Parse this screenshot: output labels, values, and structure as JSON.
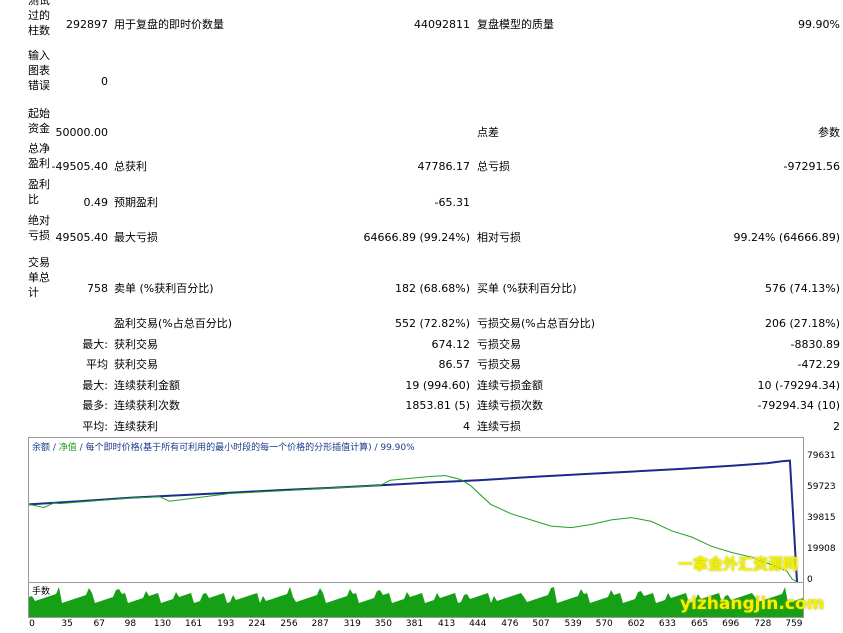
{
  "report": {
    "rows": [
      {
        "label": "测试过的柱数",
        "v1": "292897",
        "l2": "用于复盘的即时价数量",
        "v2": "44092811",
        "l3": "复盘模型的质量",
        "v3": "99.90%"
      },
      {
        "label": "输入图表错误",
        "v1": "0"
      },
      {
        "label": "起始资金",
        "v1": "50000.00",
        "l3": "点差",
        "v3": "参数"
      },
      {
        "label": "总净盈利",
        "v1": "-49505.40",
        "l2": "总获利",
        "v2": "47786.17",
        "l3": "总亏损",
        "v3": "-97291.56"
      },
      {
        "label": "盈利比",
        "v1": "0.49",
        "l2": "预期盈利",
        "v2": "-65.31"
      },
      {
        "label": "绝对亏损",
        "v1": "49505.40",
        "l2": "最大亏损",
        "v2": "64666.89 (99.24%)",
        "l3": "相对亏损",
        "v3": "99.24% (64666.89)"
      },
      {
        "label": "交易单总计",
        "v1": "758",
        "l2": "卖单 (%获利百分比)",
        "v2": "182 (68.68%)",
        "l3": "买单 (%获利百分比)",
        "v3": "576 (74.13%)"
      },
      {
        "l2": "盈利交易(%占总百分比)",
        "v2": "552 (72.82%)",
        "l3": "亏损交易(%占总百分比)",
        "v3": "206 (27.18%)"
      },
      {
        "cat": "最大:",
        "l2": "获利交易",
        "v2": "674.12",
        "l3": "亏损交易",
        "v3": "-8830.89"
      },
      {
        "cat": "平均",
        "l2": "获利交易",
        "v2": "86.57",
        "l3": "亏损交易",
        "v3": "-472.29"
      },
      {
        "cat": "最大:",
        "l2": "连续获利金额",
        "v2": "19 (994.60)",
        "l3": "连续亏损金额",
        "v3": "10 (-79294.34)"
      },
      {
        "cat": "最多:",
        "l2": "连续获利次数",
        "v2": "1853.81 (5)",
        "l3": "连续亏损次数",
        "v3": "-79294.34 (10)"
      },
      {
        "cat": "平均:",
        "l2": "连续获利",
        "v2": "4",
        "l3": "连续亏损",
        "v3": "2"
      }
    ]
  },
  "chart": {
    "title_balance": "余额",
    "title_equity": "净值",
    "title_rest": "每个即时价格(基于所有可利用的最小时段的每一个价格的分形插值计算)",
    "quality": "99.90%",
    "volume_label": "手数",
    "colors": {
      "balance": "#1b2a8c",
      "equity": "#21a021",
      "volume": "#16a016"
    }
  },
  "chart_data": {
    "type": "line",
    "ylim": [
      0,
      85000
    ],
    "y_ticks": [
      "79631",
      "59723",
      "39815",
      "19908",
      "0"
    ],
    "x_ticks": [
      "0",
      "35",
      "67",
      "98",
      "130",
      "161",
      "193",
      "224",
      "256",
      "287",
      "319",
      "350",
      "381",
      "413",
      "444",
      "476",
      "507",
      "539",
      "570",
      "602",
      "633",
      "665",
      "696",
      "728",
      "759"
    ],
    "xlim": [
      0,
      771
    ],
    "series": [
      {
        "key": "balance",
        "x": [
          0,
          50,
          100,
          150,
          200,
          250,
          300,
          350,
          400,
          450,
          500,
          550,
          600,
          650,
          700,
          735,
          750,
          758,
          765
        ],
        "y": [
          50000,
          52000,
          54200,
          55800,
          57500,
          59200,
          60600,
          62300,
          64100,
          65600,
          67600,
          69400,
          71100,
          72800,
          74900,
          76500,
          77800,
          78200,
          0
        ]
      },
      {
        "key": "equity",
        "x": [
          0,
          15,
          25,
          30,
          60,
          100,
          130,
          140,
          200,
          260,
          300,
          330,
          350,
          360,
          400,
          415,
          430,
          440,
          460,
          480,
          500,
          520,
          540,
          560,
          580,
          600,
          620,
          640,
          660,
          680,
          700,
          720,
          740,
          755,
          760,
          765
        ],
        "y": [
          50000,
          48000,
          51000,
          50500,
          52000,
          54000,
          55000,
          52000,
          57000,
          59000,
          60500,
          61500,
          62300,
          65500,
          68000,
          68500,
          66000,
          62000,
          50000,
          44000,
          40000,
          36000,
          35000,
          37000,
          40000,
          41500,
          39000,
          33000,
          29000,
          23000,
          19000,
          16000,
          11000,
          7000,
          2000,
          0
        ]
      }
    ]
  }
}
